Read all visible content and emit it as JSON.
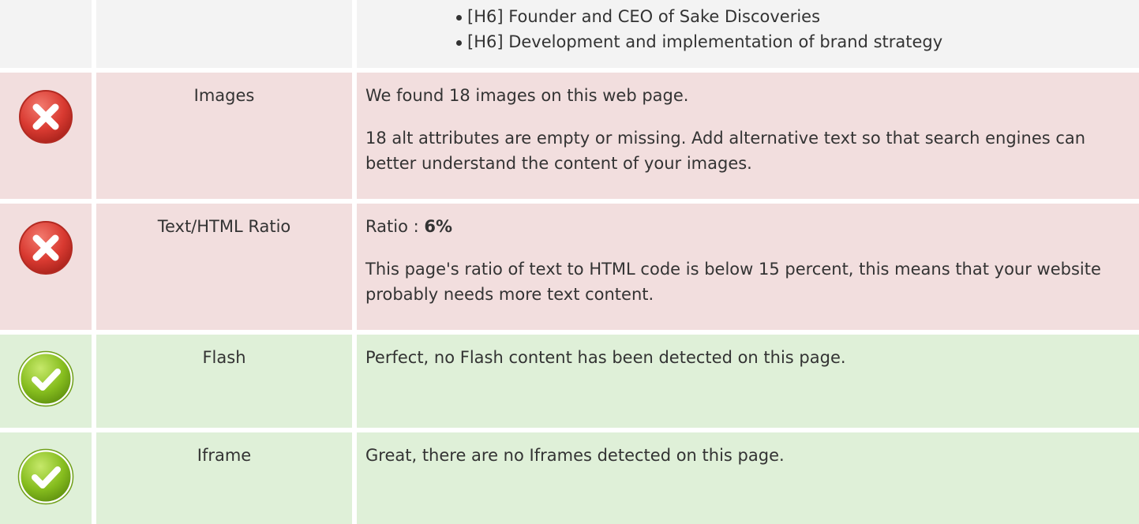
{
  "top_section": {
    "headings": [
      "[H6] Founder and CEO of Sake Discoveries",
      "[H6] Development and implementation of brand strategy"
    ]
  },
  "rows": [
    {
      "status": "error",
      "status_icon": "error-x-icon",
      "label": "Images",
      "paragraphs": [
        "We found 18 images on this web page.",
        "18 alt attributes are empty or missing. Add alternative text so that search engines can better understand the content of your images."
      ]
    },
    {
      "status": "error",
      "status_icon": "error-x-icon",
      "label": "Text/HTML Ratio",
      "ratio_prefix": "Ratio : ",
      "ratio_value": "6%",
      "paragraphs": [
        "This page's ratio of text to HTML code is below 15 percent, this means that your website probably needs more text content."
      ]
    },
    {
      "status": "ok",
      "status_icon": "check-icon",
      "label": "Flash",
      "paragraphs": [
        "Perfect, no Flash content has been detected on this page."
      ]
    },
    {
      "status": "ok",
      "status_icon": "check-icon",
      "label": "Iframe",
      "paragraphs": [
        "Great, there are no Iframes detected on this page."
      ]
    }
  ],
  "colors": {
    "error_bg": "#f2dede",
    "ok_bg": "#dff0d8",
    "neutral_bg": "#f3f3f3",
    "error_icon": "#dd3b3b",
    "ok_icon": "#7cb518"
  }
}
